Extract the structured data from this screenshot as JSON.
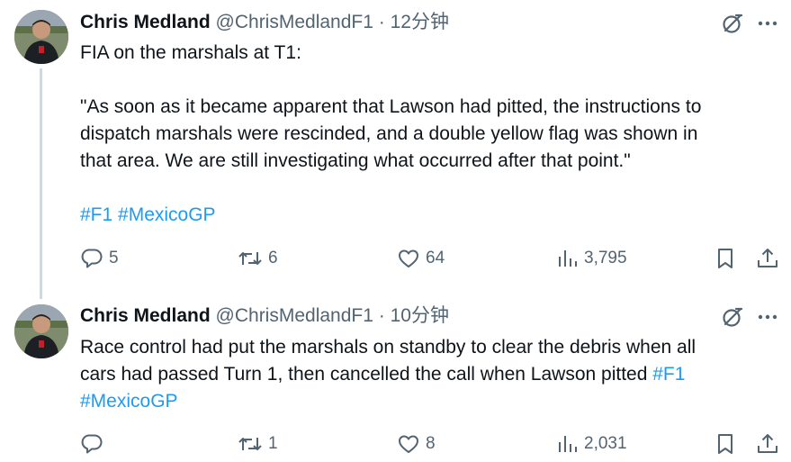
{
  "tweets": [
    {
      "author_name": "Chris Medland",
      "handle": "@ChrisMedlandF1",
      "separator": "·",
      "time": "12分钟",
      "lines": [
        "FIA on the marshals at T1:",
        "",
        "\"As soon as it became apparent that Lawson had pitted, the instructions to",
        "dispatch marshals were rescinded, and a double yellow flag was shown in",
        "that area. We are still investigating what occurred after that point.\"",
        ""
      ],
      "hashtag_1": "#F1",
      "hashtag_2": "#MexicoGP",
      "replies": "5",
      "retweets": "6",
      "likes": "64",
      "views": "3,795"
    },
    {
      "author_name": "Chris Medland",
      "handle": "@ChrisMedlandF1",
      "separator": "·",
      "time": "10分钟",
      "line_1": "Race control had put the marshals on standby to clear the debris when all",
      "line_2_text": "cars had passed Turn 1, then cancelled the call when Lawson pitted ",
      "hashtag_1": "#F1",
      "hashtag_2": "#MexicoGP",
      "replies": "",
      "retweets": "1",
      "likes": "8",
      "views": "2,031"
    }
  ],
  "icons": {
    "grok": "grok-icon",
    "more": "more-icon",
    "reply": "reply-icon",
    "retweet": "retweet-icon",
    "like": "heart-icon",
    "views": "views-icon",
    "bookmark": "bookmark-icon",
    "share": "share-icon"
  },
  "colors": {
    "text": "#0f1419",
    "secondary": "#536471",
    "link": "#1d9bf0",
    "thread_line": "#cfd9de"
  }
}
